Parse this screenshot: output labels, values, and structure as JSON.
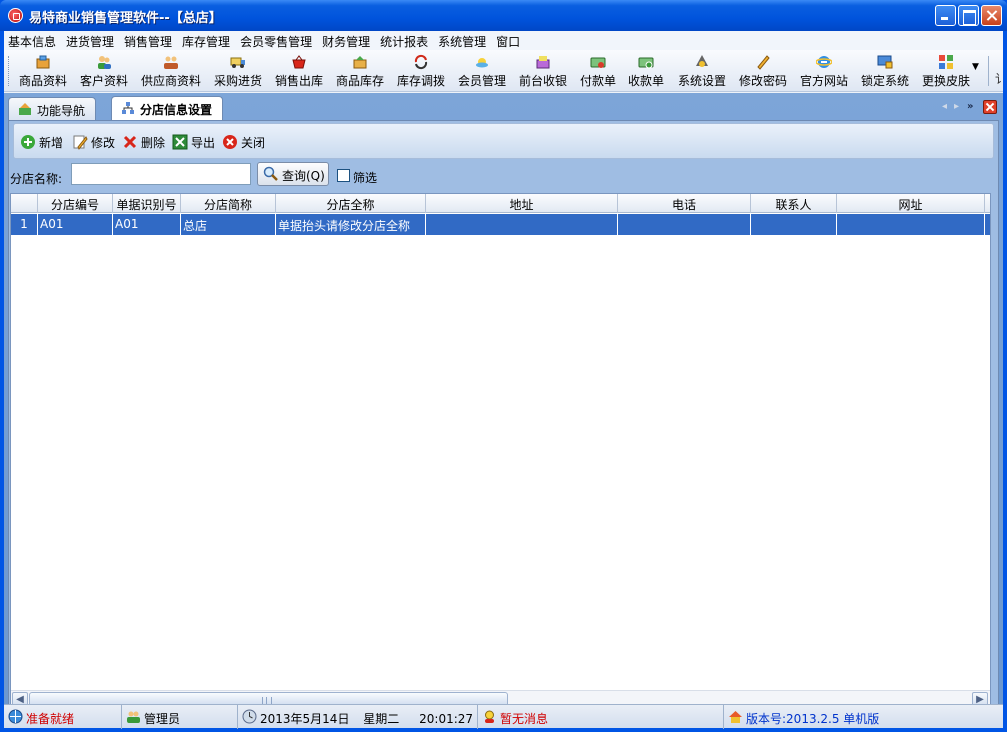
{
  "window": {
    "title": "易特商业销售管理软件--【总店】"
  },
  "menubar": {
    "items": [
      "基本信息",
      "进货管理",
      "销售管理",
      "库存管理",
      "会员零售管理",
      "财务管理",
      "统计报表",
      "系统管理",
      "窗口"
    ]
  },
  "toolbar": {
    "buttons": [
      {
        "label": "商品资料",
        "icon": "product-icon"
      },
      {
        "label": "客户资料",
        "icon": "customer-icon"
      },
      {
        "label": "供应商资料",
        "icon": "supplier-icon"
      },
      {
        "label": "采购进货",
        "icon": "purchase-truck-icon"
      },
      {
        "label": "销售出库",
        "icon": "sales-basket-icon"
      },
      {
        "label": "商品库存",
        "icon": "inventory-box-icon"
      },
      {
        "label": "库存调拨",
        "icon": "transfer-arrows-icon"
      },
      {
        "label": "会员管理",
        "icon": "member-icon"
      },
      {
        "label": "前台收银",
        "icon": "cashier-icon"
      },
      {
        "label": "付款单",
        "icon": "payment-icon"
      },
      {
        "label": "收款单",
        "icon": "receipt-icon"
      },
      {
        "label": "系统设置",
        "icon": "settings-icon"
      },
      {
        "label": "修改密码",
        "icon": "password-pen-icon"
      },
      {
        "label": "官方网站",
        "icon": "ie-browser-icon"
      },
      {
        "label": "锁定系统",
        "icon": "lock-system-icon"
      },
      {
        "label": "更换皮肤",
        "icon": "skin-palette-icon"
      }
    ],
    "overflow_label": "讠"
  },
  "tabs": [
    {
      "label": "功能导航",
      "active": false
    },
    {
      "label": "分店信息设置",
      "active": true
    }
  ],
  "actions": {
    "add": "新增",
    "edit": "修改",
    "delete": "删除",
    "export": "导出",
    "close": "关闭"
  },
  "search": {
    "label": "分店名称:",
    "value": "",
    "query_button": "查询(Q)",
    "filter_label": "筛选",
    "filter_checked": false
  },
  "grid": {
    "columns": [
      "",
      "分店编号",
      "单据识别号",
      "分店简称",
      "分店全称",
      "地址",
      "电话",
      "联系人",
      "网址"
    ],
    "rows": [
      {
        "rownum": "1",
        "cells": [
          "A01",
          "A01",
          "总店",
          "单据抬头请修改分店全称",
          "",
          "",
          "",
          ""
        ],
        "selected": true
      }
    ]
  },
  "statusbar": {
    "status": "准备就绪",
    "user": "管理员",
    "date": "2013年5月14日",
    "weekday": "星期二",
    "time": "20:01:27",
    "message": "暂无消息",
    "version": "版本号:2013.2.5 单机版"
  },
  "colors": {
    "titlebar": "#0053dc",
    "selection": "#316ac5",
    "status_red": "#d00000",
    "version_blue": "#0033cc"
  }
}
